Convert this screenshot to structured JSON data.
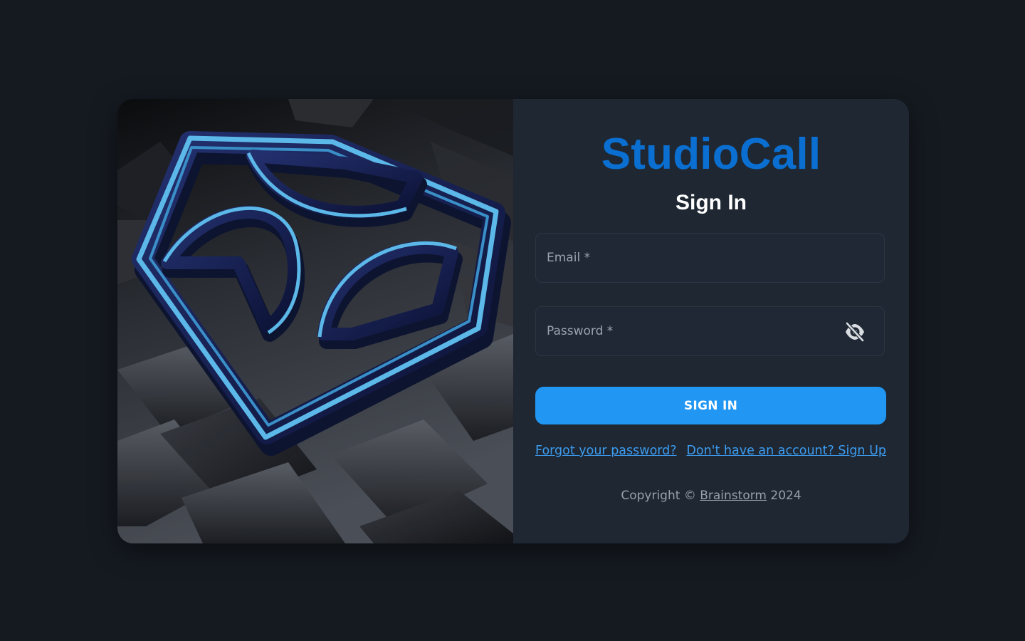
{
  "brand": {
    "name": "StudioCall"
  },
  "form": {
    "heading": "Sign In",
    "email_placeholder": "Email *",
    "password_placeholder": "Password *",
    "submit_label": "SIGN IN"
  },
  "links": {
    "forgot_password": "Forgot your password?",
    "sign_up": "Don't have an account? Sign Up"
  },
  "footer": {
    "prefix": "Copyright ©",
    "company": "Brainstorm",
    "year": "2024"
  },
  "icons": {
    "password_toggle": "eye-off-icon",
    "hero_logo": "studiocall-3d-logo"
  },
  "colors": {
    "page_background": "#151a21",
    "panel_background": "#1e2732",
    "brand": "#0a6fd1",
    "primary_button": "#2196f3",
    "link": "#3d9cf0",
    "logo_neon": "#5cb8e8"
  }
}
